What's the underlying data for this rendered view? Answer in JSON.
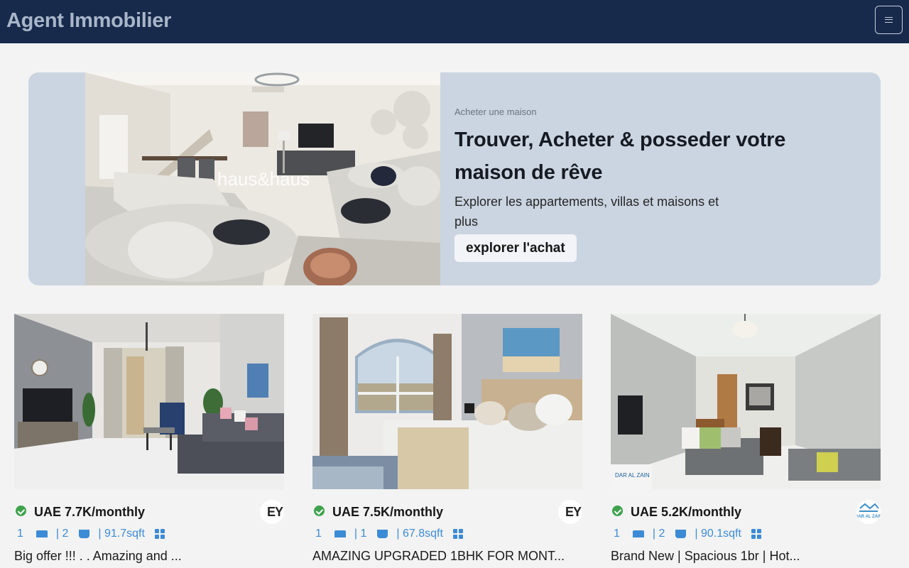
{
  "header": {
    "brand": "Agent Immobilier",
    "menu_icon": "hamburger-icon"
  },
  "hero": {
    "eyebrow": "Acheter une maison",
    "title": "Trouver, Acheter & posseder votre maison de rêve",
    "subtitle": "Explorer les appartements, villas et maisons et plus",
    "cta": "explorer l'achat",
    "photo_watermark": "haus&haus"
  },
  "listings": [
    {
      "price": "UAE 7.7K/monthly",
      "beds": "1",
      "baths": "| 2",
      "area": "| 91.7sqft",
      "title": "Big offer !!! . . Amazing and ...",
      "agency_logo_text": "EY",
      "verified": true
    },
    {
      "price": "UAE 7.5K/monthly",
      "beds": "1",
      "baths": "| 1",
      "area": "| 67.8sqft",
      "title": "AMAZING UPGRADED 1BHK FOR MONT...",
      "agency_logo_text": "EY",
      "verified": true
    },
    {
      "price": "UAE 5.2K/monthly",
      "beds": "1",
      "baths": "| 2",
      "area": "| 90.1sqft",
      "title": "Brand New | Spacious 1br | Hot...",
      "agency_logo_text": "DAR AL ZAIN",
      "verified": true
    }
  ],
  "icons": {
    "verified": "check-circle-icon",
    "beds": "bed-icon",
    "baths": "bath-icon",
    "area": "grid-icon"
  }
}
